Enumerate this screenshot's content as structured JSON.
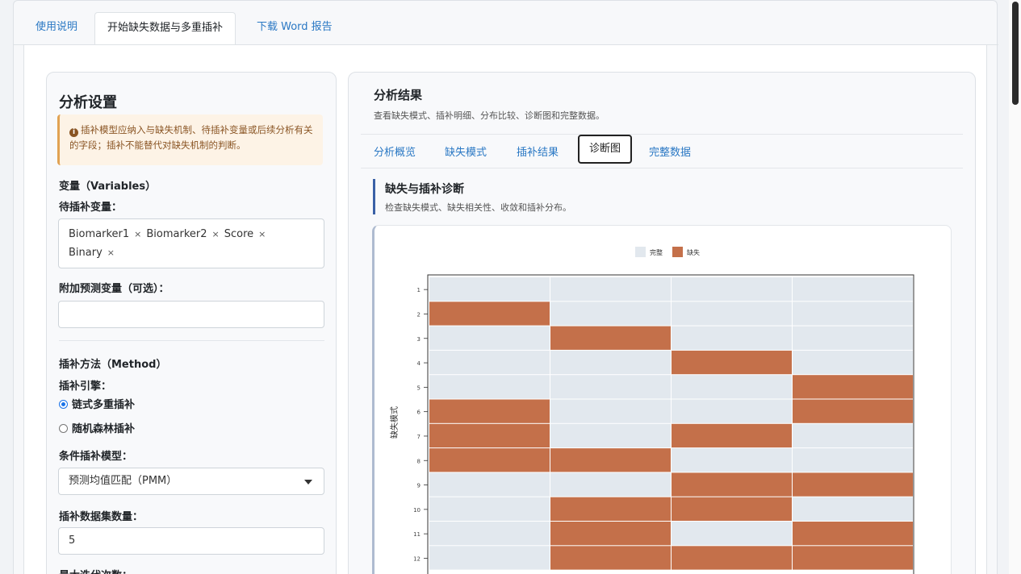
{
  "top_tabs": [
    "使用说明",
    "开始缺失数据与多重插补",
    "下载 Word 报告"
  ],
  "left": {
    "title": "分析设置",
    "notice": "插补模型应纳入与缺失机制、待插补变量或后续分析有关的字段；插补不能替代对缺失机制的判断。",
    "variables_section": "变量（Variables）",
    "impute_vars_label": "待插补变量：",
    "impute_vars": [
      "Biomarker1",
      "Biomarker2",
      "Score",
      "Binary"
    ],
    "extra_predictors_label": "附加预测变量（可选）：",
    "method_section": "插补方法（Method）",
    "engine_label": "插补引擎：",
    "engine_options": [
      "链式多重插补",
      "随机森林插补"
    ],
    "cond_model_label": "条件插补模型：",
    "cond_model_value": "预测均值匹配（PMM）",
    "n_imputations_label": "插补数据集数量：",
    "n_imputations_value": "5",
    "max_iter_label": "最大迭代次数："
  },
  "right": {
    "title": "分析结果",
    "subtitle": "查看缺失模式、插补明细、分布比较、诊断图和完整数据。",
    "tabs": [
      "分析概览",
      "缺失模式",
      "插补结果",
      "诊断图",
      "完整数据"
    ],
    "active_tab": "诊断图",
    "section_title": "缺失与插补诊断",
    "section_subtitle": "检查缺失模式、缺失相关性、收敛和插补分布。"
  },
  "colors": {
    "complete": "#e2e8ee",
    "missing": "#c4704a",
    "link": "#2a78c4"
  },
  "chart_data": {
    "type": "heatmap",
    "legend": [
      "完整",
      "缺失"
    ],
    "legend_position": "top",
    "ylabel": "缺失模式",
    "rows": [
      "1",
      "2",
      "3",
      "4",
      "5",
      "6",
      "7",
      "8",
      "9",
      "10",
      "11",
      "12"
    ],
    "n_columns": 4,
    "values": [
      [
        0,
        0,
        0,
        0
      ],
      [
        1,
        0,
        0,
        0
      ],
      [
        0,
        1,
        0,
        0
      ],
      [
        0,
        0,
        1,
        0
      ],
      [
        0,
        0,
        0,
        1
      ],
      [
        1,
        0,
        0,
        1
      ],
      [
        1,
        0,
        1,
        0
      ],
      [
        1,
        1,
        0,
        0
      ],
      [
        0,
        0,
        1,
        1
      ],
      [
        0,
        1,
        1,
        0
      ],
      [
        0,
        1,
        0,
        1
      ],
      [
        0,
        1,
        1,
        1
      ]
    ]
  }
}
